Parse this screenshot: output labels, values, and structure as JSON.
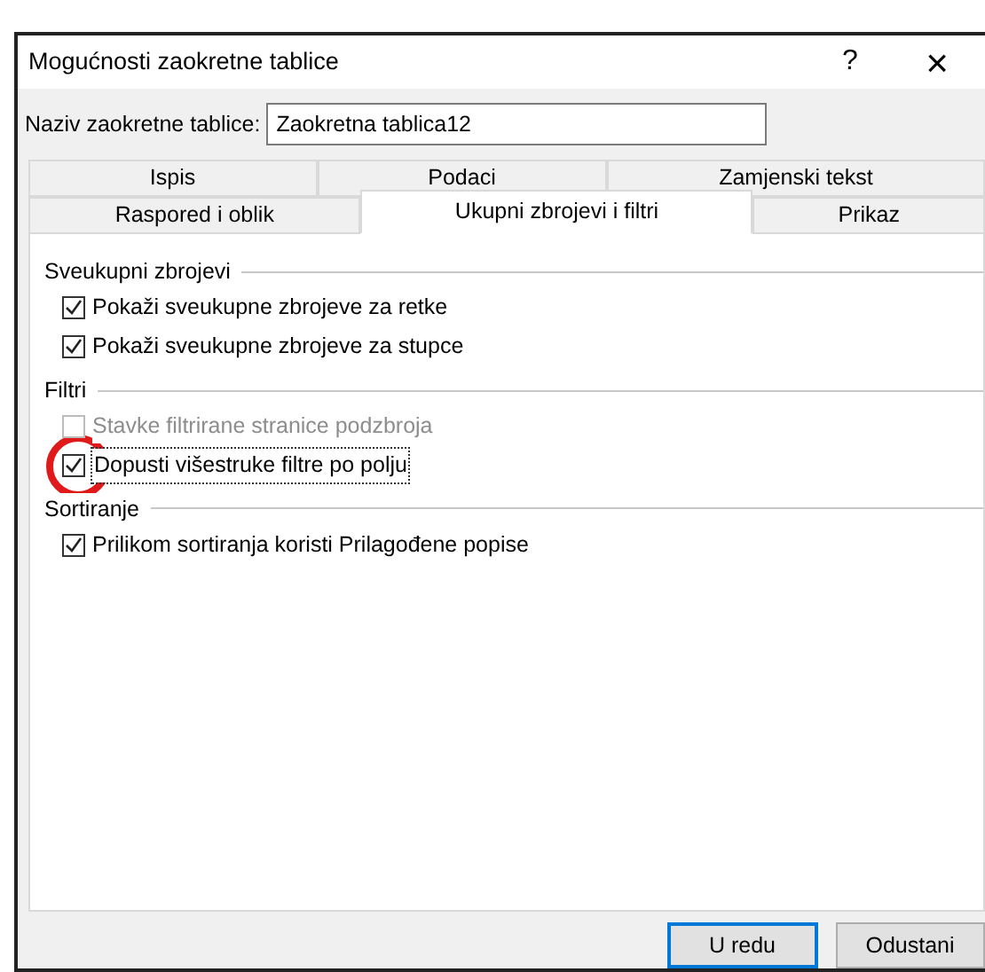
{
  "window": {
    "title": "Mogućnosti zaokretne tablice",
    "help": "?",
    "close": "×"
  },
  "name_field": {
    "label": "Naziv zaokretne tablice:",
    "value": "Zaokretna tablica12"
  },
  "tab_rows": [
    [
      {
        "label": "Ispis",
        "selected": false
      },
      {
        "label": "Podaci",
        "selected": false
      },
      {
        "label": "Zamjenski tekst",
        "selected": false
      }
    ],
    [
      {
        "label": "Raspored i oblik",
        "selected": false
      },
      {
        "label": "Ukupni zbrojevi i filtri",
        "selected": true
      },
      {
        "label": "Prikaz",
        "selected": false
      }
    ]
  ],
  "sections": [
    {
      "title": "Sveukupni zbrojevi",
      "items": [
        {
          "label": "Pokaži sveukupne zbrojeve za retke",
          "checked": true,
          "disabled": false,
          "focused": false,
          "circled": false
        },
        {
          "label": "Pokaži sveukupne zbrojeve za stupce",
          "checked": true,
          "disabled": false,
          "focused": false,
          "circled": false
        }
      ]
    },
    {
      "title": "Filtri",
      "items": [
        {
          "label": "Stavke filtrirane stranice podzbroja",
          "checked": false,
          "disabled": true,
          "focused": false,
          "circled": false
        },
        {
          "label": "Dopusti višestruke filtre po polju",
          "checked": true,
          "disabled": false,
          "focused": true,
          "circled": true
        }
      ]
    },
    {
      "title": "Sortiranje",
      "items": [
        {
          "label": "Prilikom sortiranja koristi Prilagođene popise",
          "checked": true,
          "disabled": false,
          "focused": false,
          "circled": false
        }
      ]
    }
  ],
  "buttons": [
    {
      "label": "U redu",
      "default": true
    },
    {
      "label": "Odustani",
      "default": false
    }
  ]
}
